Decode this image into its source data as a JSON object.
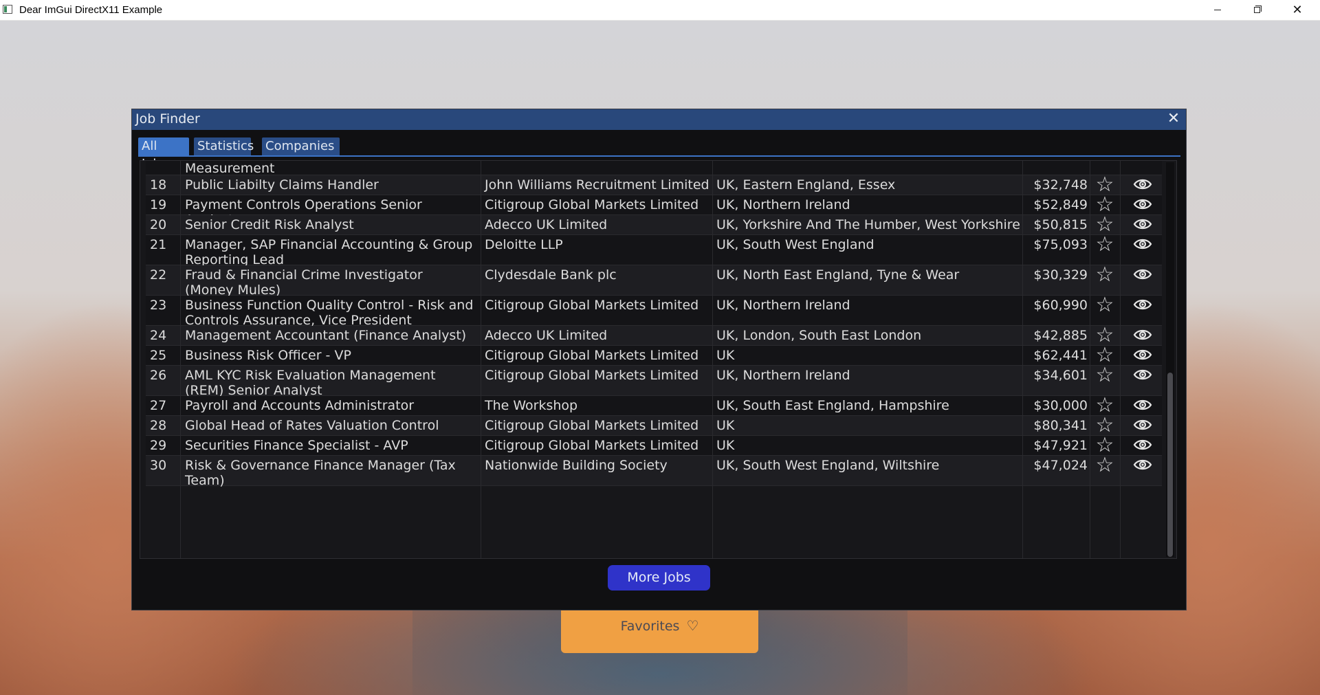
{
  "os_window": {
    "title": "Dear ImGui DirectX11 Example",
    "controls": {
      "minimize_icon": "minimize-icon",
      "maximize_icon": "restore-icon",
      "close_icon": "close-icon",
      "close_glyph": "✕"
    }
  },
  "background": {
    "favorites_label": "Favorites",
    "favorites_icon": "heart-icon",
    "favorites_glyph": "♡",
    "accent_color": "#f0a043"
  },
  "imgui": {
    "title": "Job Finder",
    "close_glyph": "✕",
    "tabs": [
      {
        "label": "All Jobs",
        "active": true
      },
      {
        "label": "Statistics",
        "active": false
      },
      {
        "label": "Companies",
        "active": false
      }
    ],
    "table": {
      "partial_row": {
        "title": "Measurement"
      },
      "rows": [
        {
          "num": "18",
          "title": "Public Liabilty Claims Handler",
          "company": "John Williams Recruitment Limited",
          "location": "UK, Eastern England, Essex",
          "salary": "$32,748"
        },
        {
          "num": "19",
          "title": "Payment Controls Operations Senior Analyst",
          "company": "Citigroup Global Markets Limited",
          "location": "UK, Northern Ireland",
          "salary": "$52,849"
        },
        {
          "num": "20",
          "title": "Senior Credit Risk Analyst",
          "company": "Adecco UK Limited",
          "location": "UK, Yorkshire And The Humber, West Yorkshire",
          "salary": "$50,815"
        },
        {
          "num": "21",
          "title": "Manager, SAP Financial Accounting & Group Reporting Lead",
          "company": "Deloitte LLP",
          "location": "UK, South West England",
          "salary": "$75,093"
        },
        {
          "num": "22",
          "title": "Fraud & Financial Crime Investigator (Money Mules)",
          "company": "Clydesdale Bank plc",
          "location": "UK, North East England, Tyne & Wear",
          "salary": "$30,329"
        },
        {
          "num": "23",
          "title": "Business Function Quality Control - Risk and Controls Assurance, Vice President",
          "company": "Citigroup Global Markets Limited",
          "location": "UK, Northern Ireland",
          "salary": "$60,990"
        },
        {
          "num": "24",
          "title": "Management Accountant (Finance Analyst)",
          "company": "Adecco UK Limited",
          "location": "UK, London, South East London",
          "salary": "$42,885"
        },
        {
          "num": "25",
          "title": "Business Risk Officer - VP",
          "company": "Citigroup Global Markets Limited",
          "location": "UK",
          "salary": "$62,441"
        },
        {
          "num": "26",
          "title": "AML KYC Risk Evaluation Management (REM) Senior Analyst",
          "company": "Citigroup Global Markets Limited",
          "location": "UK, Northern Ireland",
          "salary": "$34,601"
        },
        {
          "num": "27",
          "title": "Payroll and Accounts Administrator",
          "company": "The Workshop",
          "location": "UK, South East England, Hampshire",
          "salary": "$30,000"
        },
        {
          "num": "28",
          "title": "Global Head of Rates Valuation Control",
          "company": "Citigroup Global Markets Limited",
          "location": "UK",
          "salary": "$80,341"
        },
        {
          "num": "29",
          "title": "Securities Finance Specialist - AVP",
          "company": "Citigroup Global Markets Limited",
          "location": "UK",
          "salary": "$47,921"
        },
        {
          "num": "30",
          "title": "Risk & Governance Finance Manager (Tax Team)",
          "company": "Nationwide Building Society",
          "location": "UK, South West England, Wiltshire",
          "salary": "$47,024"
        }
      ],
      "favorite_icon": "star-outline-icon",
      "favorite_glyph": "☆",
      "view_icon": "eye-icon"
    },
    "more_jobs_label": "More Jobs",
    "colors": {
      "titlebar": "#29487b",
      "tab_active": "#3c73c6",
      "tab_inactive": "#2a4d87",
      "button": "#2f33c9",
      "window_bg": "#101012"
    }
  }
}
